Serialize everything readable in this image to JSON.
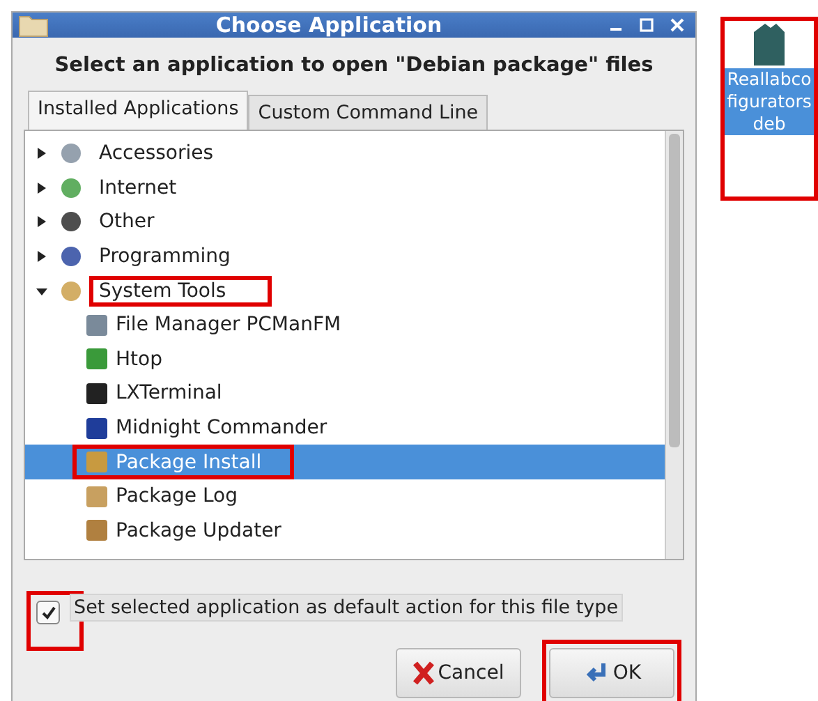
{
  "window": {
    "title": "Choose Application"
  },
  "heading": "Select an application to open \"Debian package\" files",
  "tabs": [
    {
      "label": "Installed Applications",
      "selected": true
    },
    {
      "label": "Custom Command Line",
      "selected": false
    }
  ],
  "tree": [
    {
      "label": "Accessories",
      "expanded": false,
      "highlighted": false
    },
    {
      "label": "Internet",
      "expanded": false,
      "highlighted": false
    },
    {
      "label": "Other",
      "expanded": false,
      "highlighted": false
    },
    {
      "label": "Programming",
      "expanded": false,
      "highlighted": false
    },
    {
      "label": "System Tools",
      "expanded": true,
      "highlighted": true,
      "children": [
        {
          "label": "File Manager PCManFM",
          "selected": false,
          "highlighted": false
        },
        {
          "label": "Htop",
          "selected": false,
          "highlighted": false
        },
        {
          "label": "LXTerminal",
          "selected": false,
          "highlighted": false
        },
        {
          "label": "Midnight Commander",
          "selected": false,
          "highlighted": false
        },
        {
          "label": "Package Install",
          "selected": true,
          "highlighted": true
        },
        {
          "label": "Package Log",
          "selected": false,
          "highlighted": false
        },
        {
          "label": "Package Updater",
          "selected": false,
          "highlighted": false
        }
      ]
    }
  ],
  "default_checkbox": {
    "label": "Set selected application as default action for this file type",
    "checked": true,
    "highlighted": true
  },
  "buttons": [
    {
      "label": "Cancel",
      "kind": "cancel",
      "highlighted": false
    },
    {
      "label": "OK",
      "kind": "ok",
      "highlighted": true
    }
  ],
  "desktop_icon": {
    "lines": [
      "Reallabco",
      "figurators",
      "deb"
    ],
    "selected": true,
    "highlighted": true
  }
}
